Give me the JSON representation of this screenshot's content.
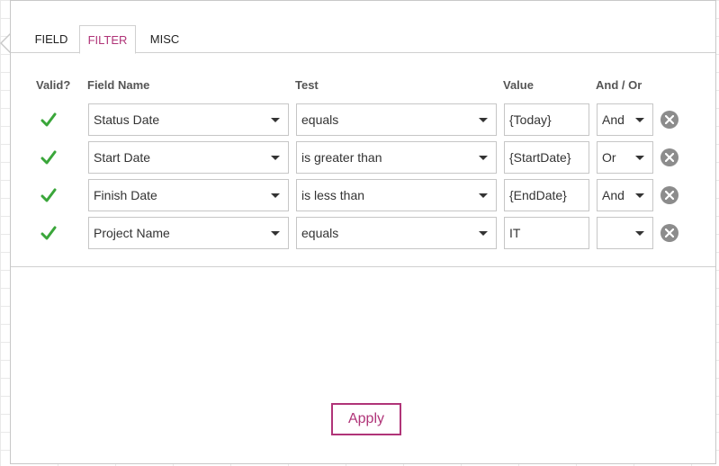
{
  "tabs": [
    {
      "label": "FIELD"
    },
    {
      "label": "FILTER"
    },
    {
      "label": "MISC"
    }
  ],
  "active_tab": "FILTER",
  "columns": {
    "valid": "Valid?",
    "field_name": "Field Name",
    "test": "Test",
    "value": "Value",
    "and_or": "And / Or"
  },
  "rows": [
    {
      "valid": true,
      "field": "Status Date",
      "test": "equals",
      "value": "{Today}",
      "and_or": "And"
    },
    {
      "valid": true,
      "field": "Start Date",
      "test": "is greater than",
      "value": "{StartDate}",
      "and_or": "Or"
    },
    {
      "valid": true,
      "field": "Finish Date",
      "test": "is less than",
      "value": "{EndDate}",
      "and_or": "And"
    },
    {
      "valid": true,
      "field": "Project Name",
      "test": "equals",
      "value": "IT",
      "and_or": ""
    }
  ],
  "apply_label": "Apply",
  "colors": {
    "accent": "#b03478",
    "valid_check": "#3aa63a",
    "remove_icon": "#8c8c8c"
  },
  "icons": {
    "valid": "check-icon",
    "remove": "remove-circle-icon",
    "dropdown": "chevron-down-icon"
  }
}
